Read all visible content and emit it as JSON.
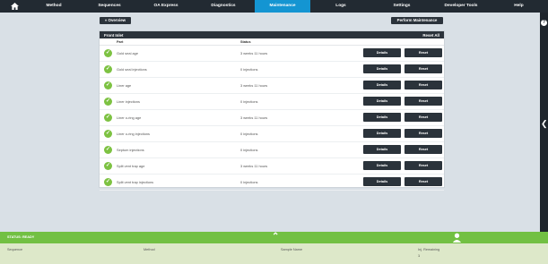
{
  "nav": {
    "items": [
      {
        "label": "Method",
        "width": 56
      },
      {
        "label": "Sequences",
        "width": 68
      },
      {
        "label": "OA Express",
        "width": 58
      },
      {
        "label": "Diagnostics",
        "width": 70
      },
      {
        "label": "Maintenance",
        "width": 62
      },
      {
        "label": "Logs",
        "width": 68
      },
      {
        "label": "Settings",
        "width": 68
      },
      {
        "label": "Developer Tools",
        "width": 64
      },
      {
        "label": "Help",
        "width": 65
      }
    ],
    "active_index": 4
  },
  "toolbar": {
    "overview_label": "« Overview",
    "perform_label": "Perform Maintenance"
  },
  "panel": {
    "title": "Front Inlet",
    "reset_all": "Reset All",
    "col_part": "Part",
    "col_status": "Status",
    "details_label": "Details",
    "reset_label": "Reset",
    "rows": [
      {
        "part": "Gold seal age",
        "status": "3 weeks 11 hours"
      },
      {
        "part": "Gold seal injections",
        "status": "0 injections"
      },
      {
        "part": "Liner age",
        "status": "3 weeks 11 hours"
      },
      {
        "part": "Liner injections",
        "status": "0 injections"
      },
      {
        "part": "Liner o-ring age",
        "status": "3 weeks 11 hours"
      },
      {
        "part": "Liner o-ring injections",
        "status": "0 injections"
      },
      {
        "part": "Septum injections",
        "status": "0 injections"
      },
      {
        "part": "Split vent trap age",
        "status": "3 weeks 11 hours"
      },
      {
        "part": "Split vent trap injections",
        "status": "0 injections"
      }
    ]
  },
  "status_bar": {
    "label": "STATUS: READY"
  },
  "bottom": {
    "sequence_label": "Sequence",
    "method_label": "Method",
    "sample_label": "Sample Name",
    "inj_label": "Inj. Remaining",
    "inj_value": "1"
  },
  "colors": {
    "nav_bg": "#222a32",
    "active": "#1495d2",
    "green": "#72c043",
    "check": "#7dc242"
  },
  "icons": {
    "home": "home-icon",
    "help": "help-icon",
    "collapse": "chevron-left-icon",
    "expand": "chevron-up-icon",
    "user": "user-icon",
    "check": "check-circle-icon"
  }
}
